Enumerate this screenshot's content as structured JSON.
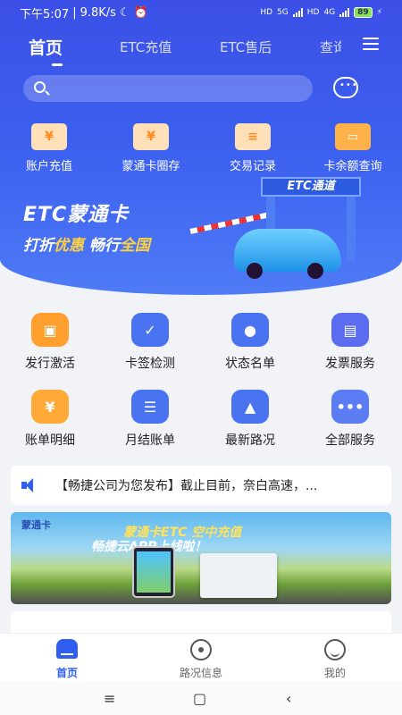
{
  "status_bar": {
    "time": "下午5:07",
    "speed": "9.8K/s",
    "net1": "5G",
    "net2": "4G",
    "hd": "HD",
    "battery": "89"
  },
  "top_nav": {
    "tabs": [
      {
        "label": "首页"
      },
      {
        "label": "ETC充值"
      },
      {
        "label": "ETC售后"
      },
      {
        "label": "查询"
      }
    ]
  },
  "search": {
    "placeholder": "",
    "value": ""
  },
  "quick_actions": [
    {
      "label": "账户充值",
      "icon": "wallet-card-icon"
    },
    {
      "label": "蒙通卡圈存",
      "icon": "card-deposit-icon"
    },
    {
      "label": "交易记录",
      "icon": "receipt-icon"
    },
    {
      "label": "卡余额查询",
      "icon": "wallet-icon"
    }
  ],
  "banner": {
    "line1": "ETC蒙通卡",
    "line2_a": "打折",
    "line2_b": "优惠",
    "line2_c": "  畅行",
    "line2_d": "全国",
    "gate_label": "ETC通道"
  },
  "services": [
    {
      "label": "发行激活",
      "icon": "activation-icon",
      "color": "#ff9f2e"
    },
    {
      "label": "卡签检测",
      "icon": "shield-check-icon",
      "color": "#4a73f2"
    },
    {
      "label": "状态名单",
      "icon": "user-status-icon",
      "color": "#4a73f2"
    },
    {
      "label": "发票服务",
      "icon": "invoice-icon",
      "color": "#5b6cf0"
    },
    {
      "label": "账单明细",
      "icon": "yen-coin-icon",
      "color": "#ffa938"
    },
    {
      "label": "月结账单",
      "icon": "monthly-bill-icon",
      "color": "#4a73f2"
    },
    {
      "label": "最新路况",
      "icon": "road-icon",
      "color": "#4a73f2"
    },
    {
      "label": "全部服务",
      "icon": "more-icon",
      "color": "#5b7cf3"
    }
  ],
  "notice": {
    "text": "【畅捷公司为您发布】截止目前，奈白高速，..."
  },
  "promo": {
    "logo": "蒙通卡",
    "line1": "蒙通卡ETC 空中充值",
    "line2": "畅捷云APP上线啦！"
  },
  "tabbar": [
    {
      "label": "首页"
    },
    {
      "label": "路况信息"
    },
    {
      "label": "我的"
    }
  ],
  "colors": {
    "primary": "#3b4fe6",
    "accent": "#2f5ef0"
  }
}
